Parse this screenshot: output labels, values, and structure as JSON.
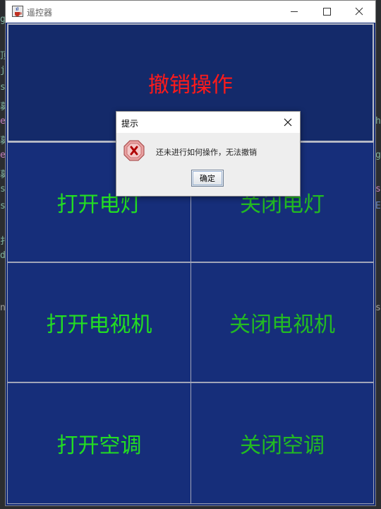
{
  "window": {
    "title": "遥控器",
    "icons": {
      "app": "java-cup-icon",
      "minimize": "minimize-icon",
      "maximize": "maximize-icon",
      "close": "close-icon"
    }
  },
  "buttons": {
    "undo": "撤销操作",
    "light_on": "打开电灯",
    "light_off": "关闭电灯",
    "tv_on": "打开电视机",
    "tv_off": "关闭电视机",
    "ac_on": "打开空调",
    "ac_off": "关闭空调"
  },
  "dialog": {
    "title": "提示",
    "message": "还未进行如何操作，无法撤销",
    "ok": "确定",
    "icon": "error-icon"
  },
  "colors": {
    "panel_bg": "#162e7a",
    "undo_text": "#ff1a1a",
    "on_text": "#22dd22",
    "off_text": "#22bb22"
  }
}
